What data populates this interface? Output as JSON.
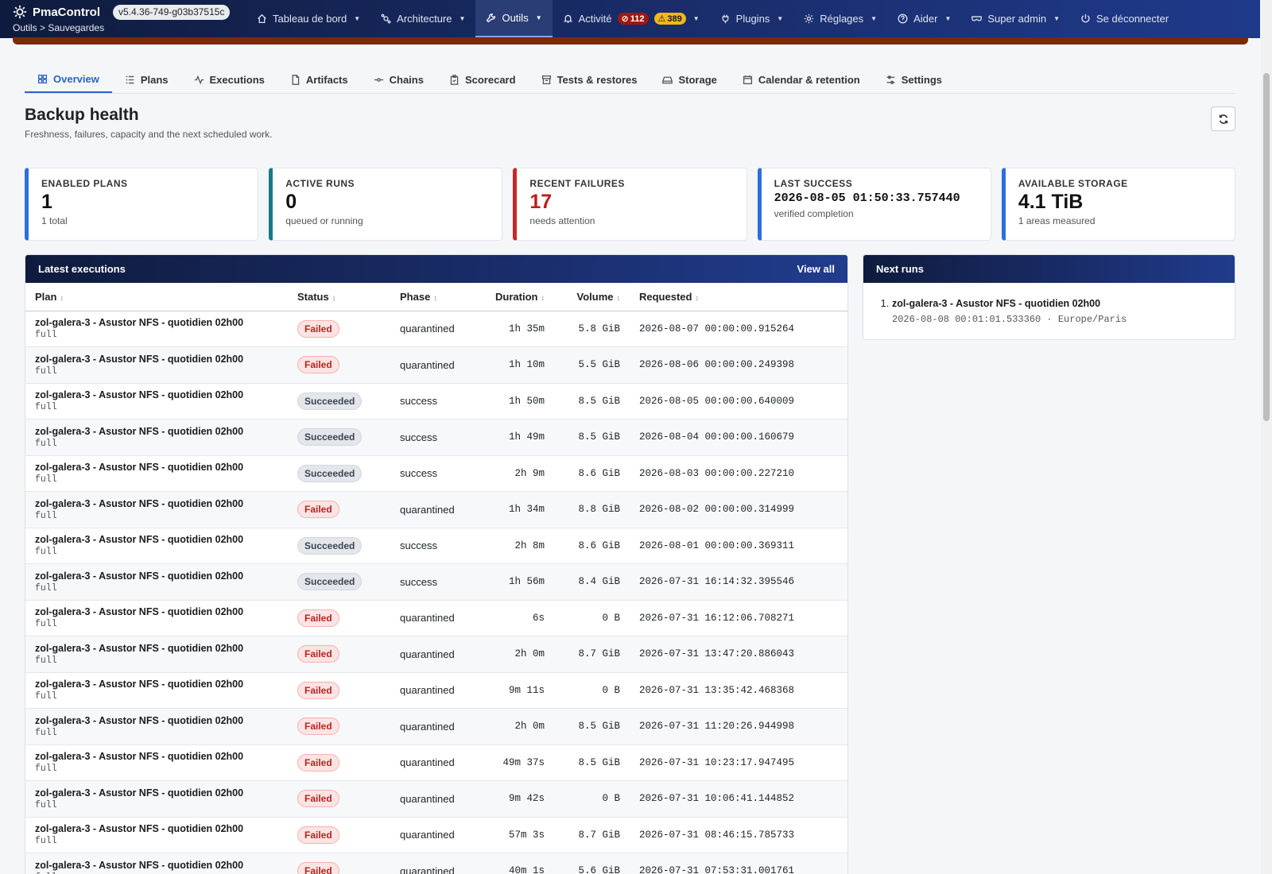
{
  "navbar": {
    "brand": "PmaControl",
    "version": "v5.4.36-749-g03b37515c",
    "breadcrumb": "Outils > Sauvegardes",
    "items": [
      {
        "label": "Tableau de bord",
        "icon": "home-icon"
      },
      {
        "label": "Architecture",
        "icon": "architecture-icon"
      },
      {
        "label": "Outils",
        "icon": "wrench-icon"
      },
      {
        "label": "Activité",
        "icon": "bell-icon",
        "badge_error": "112",
        "badge_warning": "389"
      },
      {
        "label": "Plugins",
        "icon": "plug-icon"
      },
      {
        "label": "Réglages",
        "icon": "gear-icon"
      },
      {
        "label": "Aider",
        "icon": "help-icon"
      },
      {
        "label": "Super admin",
        "icon": "mask-icon"
      },
      {
        "label": "Se déconnecter",
        "icon": "power-icon"
      }
    ],
    "colors": {
      "bar_start": "#0f1b3d",
      "bar_end": "#1f3a8a",
      "active": "#2a3d75"
    }
  },
  "tabs": [
    {
      "label": "Overview",
      "icon": "grid-icon",
      "active": true
    },
    {
      "label": "Plans",
      "icon": "list-icon"
    },
    {
      "label": "Executions",
      "icon": "activity-icon"
    },
    {
      "label": "Artifacts",
      "icon": "file-icon"
    },
    {
      "label": "Chains",
      "icon": "chain-icon"
    },
    {
      "label": "Scorecard",
      "icon": "clipboard-icon"
    },
    {
      "label": "Tests & restores",
      "icon": "archive-icon"
    },
    {
      "label": "Storage",
      "icon": "drive-icon"
    },
    {
      "label": "Calendar & retention",
      "icon": "calendar-icon"
    },
    {
      "label": "Settings",
      "icon": "sliders-icon"
    }
  ],
  "page": {
    "title": "Backup health",
    "subtitle": "Freshness, failures, capacity and the next scheduled work."
  },
  "metrics": [
    {
      "label": "ENABLED PLANS",
      "value": "1",
      "foot": "1 total",
      "accent": "#2d6ee0"
    },
    {
      "label": "ACTIVE RUNS",
      "value": "0",
      "foot": "queued or running",
      "accent": "#167a87"
    },
    {
      "label": "RECENT FAILURES",
      "value": "17",
      "foot": "needs attention",
      "accent": "#c62828"
    },
    {
      "label": "LAST SUCCESS",
      "value": "2026-08-05 01:50:33.757440",
      "foot": "verified completion",
      "accent": "#2d6ee0"
    },
    {
      "label": "AVAILABLE STORAGE",
      "value": "4.1 TiB",
      "foot": "1 areas measured",
      "accent": "#2d6ee0"
    }
  ],
  "executions": {
    "title": "Latest executions",
    "view_all": "View all",
    "columns": [
      "Plan",
      "Status",
      "Phase",
      "Duration",
      "Volume",
      "Requested"
    ],
    "rows": [
      {
        "plan": "zol-galera-3 - Asustor NFS - quotidien 02h00",
        "type": "full",
        "status": "Failed",
        "phase": "quarantined",
        "duration": "1h 35m",
        "volume": "5.8 GiB",
        "requested": "2026-08-07 00:00:00.915264"
      },
      {
        "plan": "zol-galera-3 - Asustor NFS - quotidien 02h00",
        "type": "full",
        "status": "Failed",
        "phase": "quarantined",
        "duration": "1h 10m",
        "volume": "5.5 GiB",
        "requested": "2026-08-06 00:00:00.249398"
      },
      {
        "plan": "zol-galera-3 - Asustor NFS - quotidien 02h00",
        "type": "full",
        "status": "Succeeded",
        "phase": "success",
        "duration": "1h 50m",
        "volume": "8.5 GiB",
        "requested": "2026-08-05 00:00:00.640009"
      },
      {
        "plan": "zol-galera-3 - Asustor NFS - quotidien 02h00",
        "type": "full",
        "status": "Succeeded",
        "phase": "success",
        "duration": "1h 49m",
        "volume": "8.5 GiB",
        "requested": "2026-08-04 00:00:00.160679"
      },
      {
        "plan": "zol-galera-3 - Asustor NFS - quotidien 02h00",
        "type": "full",
        "status": "Succeeded",
        "phase": "success",
        "duration": "2h 9m",
        "volume": "8.6 GiB",
        "requested": "2026-08-03 00:00:00.227210"
      },
      {
        "plan": "zol-galera-3 - Asustor NFS - quotidien 02h00",
        "type": "full",
        "status": "Failed",
        "phase": "quarantined",
        "duration": "1h 34m",
        "volume": "8.8 GiB",
        "requested": "2026-08-02 00:00:00.314999"
      },
      {
        "plan": "zol-galera-3 - Asustor NFS - quotidien 02h00",
        "type": "full",
        "status": "Succeeded",
        "phase": "success",
        "duration": "2h 8m",
        "volume": "8.6 GiB",
        "requested": "2026-08-01 00:00:00.369311"
      },
      {
        "plan": "zol-galera-3 - Asustor NFS - quotidien 02h00",
        "type": "full",
        "status": "Succeeded",
        "phase": "success",
        "duration": "1h 56m",
        "volume": "8.4 GiB",
        "requested": "2026-07-31 16:14:32.395546"
      },
      {
        "plan": "zol-galera-3 - Asustor NFS - quotidien 02h00",
        "type": "full",
        "status": "Failed",
        "phase": "quarantined",
        "duration": "6s",
        "volume": "0 B",
        "requested": "2026-07-31 16:12:06.708271"
      },
      {
        "plan": "zol-galera-3 - Asustor NFS - quotidien 02h00",
        "type": "full",
        "status": "Failed",
        "phase": "quarantined",
        "duration": "2h 0m",
        "volume": "8.7 GiB",
        "requested": "2026-07-31 13:47:20.886043"
      },
      {
        "plan": "zol-galera-3 - Asustor NFS - quotidien 02h00",
        "type": "full",
        "status": "Failed",
        "phase": "quarantined",
        "duration": "9m 11s",
        "volume": "0 B",
        "requested": "2026-07-31 13:35:42.468368"
      },
      {
        "plan": "zol-galera-3 - Asustor NFS - quotidien 02h00",
        "type": "full",
        "status": "Failed",
        "phase": "quarantined",
        "duration": "2h 0m",
        "volume": "8.5 GiB",
        "requested": "2026-07-31 11:20:26.944998"
      },
      {
        "plan": "zol-galera-3 - Asustor NFS - quotidien 02h00",
        "type": "full",
        "status": "Failed",
        "phase": "quarantined",
        "duration": "49m 37s",
        "volume": "8.5 GiB",
        "requested": "2026-07-31 10:23:17.947495"
      },
      {
        "plan": "zol-galera-3 - Asustor NFS - quotidien 02h00",
        "type": "full",
        "status": "Failed",
        "phase": "quarantined",
        "duration": "9m 42s",
        "volume": "0 B",
        "requested": "2026-07-31 10:06:41.144852"
      },
      {
        "plan": "zol-galera-3 - Asustor NFS - quotidien 02h00",
        "type": "full",
        "status": "Failed",
        "phase": "quarantined",
        "duration": "57m 3s",
        "volume": "8.7 GiB",
        "requested": "2026-07-31 08:46:15.785733"
      },
      {
        "plan": "zol-galera-3 - Asustor NFS - quotidien 02h00",
        "type": "full",
        "status": "Failed",
        "phase": "quarantined",
        "duration": "40m 1s",
        "volume": "5.6 GiB",
        "requested": "2026-07-31 07:53:31.001761"
      }
    ]
  },
  "next_runs": {
    "title": "Next runs",
    "items": [
      {
        "name": "zol-galera-3 - Asustor NFS - quotidien 02h00",
        "when": "2026-08-08 00:01:01.533360",
        "tz": "Europe/Paris"
      }
    ]
  }
}
